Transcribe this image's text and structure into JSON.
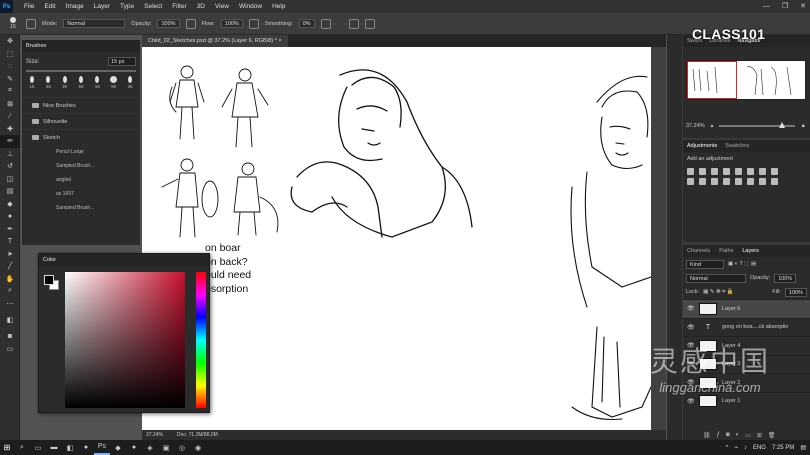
{
  "app": {
    "logo": "Ps"
  },
  "menu": [
    "File",
    "Edit",
    "Image",
    "Layer",
    "Type",
    "Select",
    "Filter",
    "3D",
    "View",
    "Window",
    "Help"
  ],
  "window_controls": [
    "—",
    "❐",
    "✕"
  ],
  "options": {
    "brush_size": "15",
    "mode_label": "Mode:",
    "mode_value": "Normal",
    "opacity_label": "Opacity:",
    "opacity_value": "100%",
    "flow_label": "Flow:",
    "flow_value": "100%",
    "smoothing_label": "Smoothing:",
    "smoothing_value": "0%"
  },
  "brushes": {
    "title": "Brushes",
    "size_label": "Size:",
    "size_value": "15 px",
    "presets": [
      "15",
      "25",
      "30",
      "50",
      "18",
      "90",
      "35"
    ],
    "groups": [
      "Nice Brushes",
      "Silhouette",
      "Sketch"
    ],
    "items": [
      "Pencil Large",
      "Sampled Brush...",
      "angled",
      "as 1697",
      "Sampled Brush..."
    ]
  },
  "document": {
    "tab": "Child_02_Sketches.psd @ 37.2% (Layer 6, RGB/8) * ×",
    "notes": [
      "on boar",
      "on back?",
      "ould need",
      "bsorption"
    ],
    "zoom": "37.24%",
    "doc_info": "Doc: 71.2M/88.0M"
  },
  "color_panel": {
    "title": "Color",
    "fg": "#000000",
    "bg": "#ffffff",
    "hue_color": "#c8102e"
  },
  "brand": "CLASS101",
  "navigator": {
    "tabs": [
      "Swars",
      "Libraries",
      "Navigator"
    ],
    "active": 2,
    "zoom": "37.24%"
  },
  "adjustments": {
    "tabs": [
      "Adjustments",
      "Swatches"
    ],
    "active": 0,
    "sub": "Add an adjustment"
  },
  "layers": {
    "tabs": [
      "Channels",
      "Paths",
      "Layers"
    ],
    "active": 2,
    "kind": "Kind",
    "blend": "Normal",
    "opacity_label": "Opacity:",
    "opacity": "100%",
    "lock_label": "Lock:",
    "fill_label": "Fill:",
    "fill": "100%",
    "items": [
      {
        "name": "Layer 6",
        "type": "image",
        "selected": true
      },
      {
        "name": "gong on boa....ck absorptio",
        "type": "text",
        "selected": false
      },
      {
        "name": "Layer 4",
        "type": "image",
        "selected": false
      },
      {
        "name": "Layer 3",
        "type": "image",
        "selected": false
      },
      {
        "name": "Layer 2",
        "type": "image",
        "selected": false
      },
      {
        "name": "Layer 1",
        "type": "image",
        "selected": false
      }
    ]
  },
  "watermark": {
    "zh": "灵感中国",
    "en": "lingganchina.com"
  },
  "taskbar": {
    "lang": "ENG",
    "time": "7:25 PM"
  }
}
